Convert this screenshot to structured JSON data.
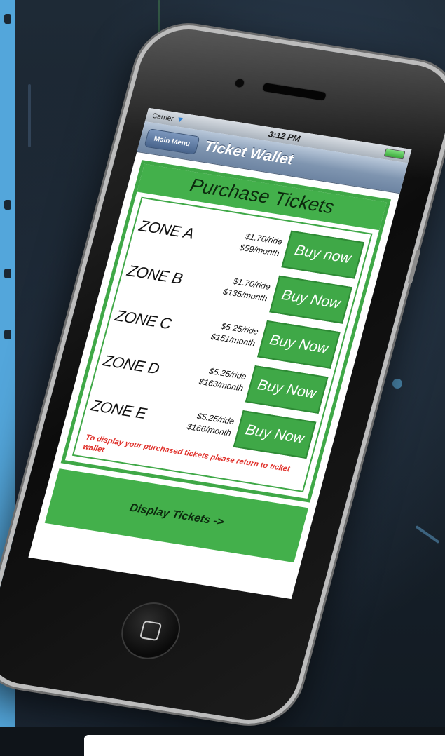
{
  "status_bar": {
    "carrier": "Carrier",
    "time": "3:12 PM"
  },
  "nav_bar": {
    "back_label": "Main Menu",
    "title": "Ticket Wallet"
  },
  "panel": {
    "title": "Purchase Tickets",
    "zones": [
      {
        "name": "ZONE A",
        "ride": "$1.70/ride",
        "month": "$59/month",
        "button": "Buy now"
      },
      {
        "name": "ZONE B",
        "ride": "$1.70/ride",
        "month": "$135/month",
        "button": "Buy Now"
      },
      {
        "name": "ZONE C",
        "ride": "$5.25/ride",
        "month": "$151/month",
        "button": "Buy Now"
      },
      {
        "name": "ZONE D",
        "ride": "$5.25/ride",
        "month": "$163/month",
        "button": "Buy Now"
      },
      {
        "name": "ZONE E",
        "ride": "$5.25/ride",
        "month": "$166/month",
        "button": "Buy Now"
      }
    ],
    "note": "To display your purchased tickets please return to ticket wallet"
  },
  "display_button_label": "Display Tickets ->",
  "colors": {
    "accent_green": "#43b04b",
    "note_red": "#e0312b",
    "nav_blue": "#7f95b0",
    "side_panel_blue": "#53a6db"
  },
  "icons": {
    "wifi": "wifi-icon",
    "battery": "battery-icon",
    "home": "home-button-icon"
  }
}
